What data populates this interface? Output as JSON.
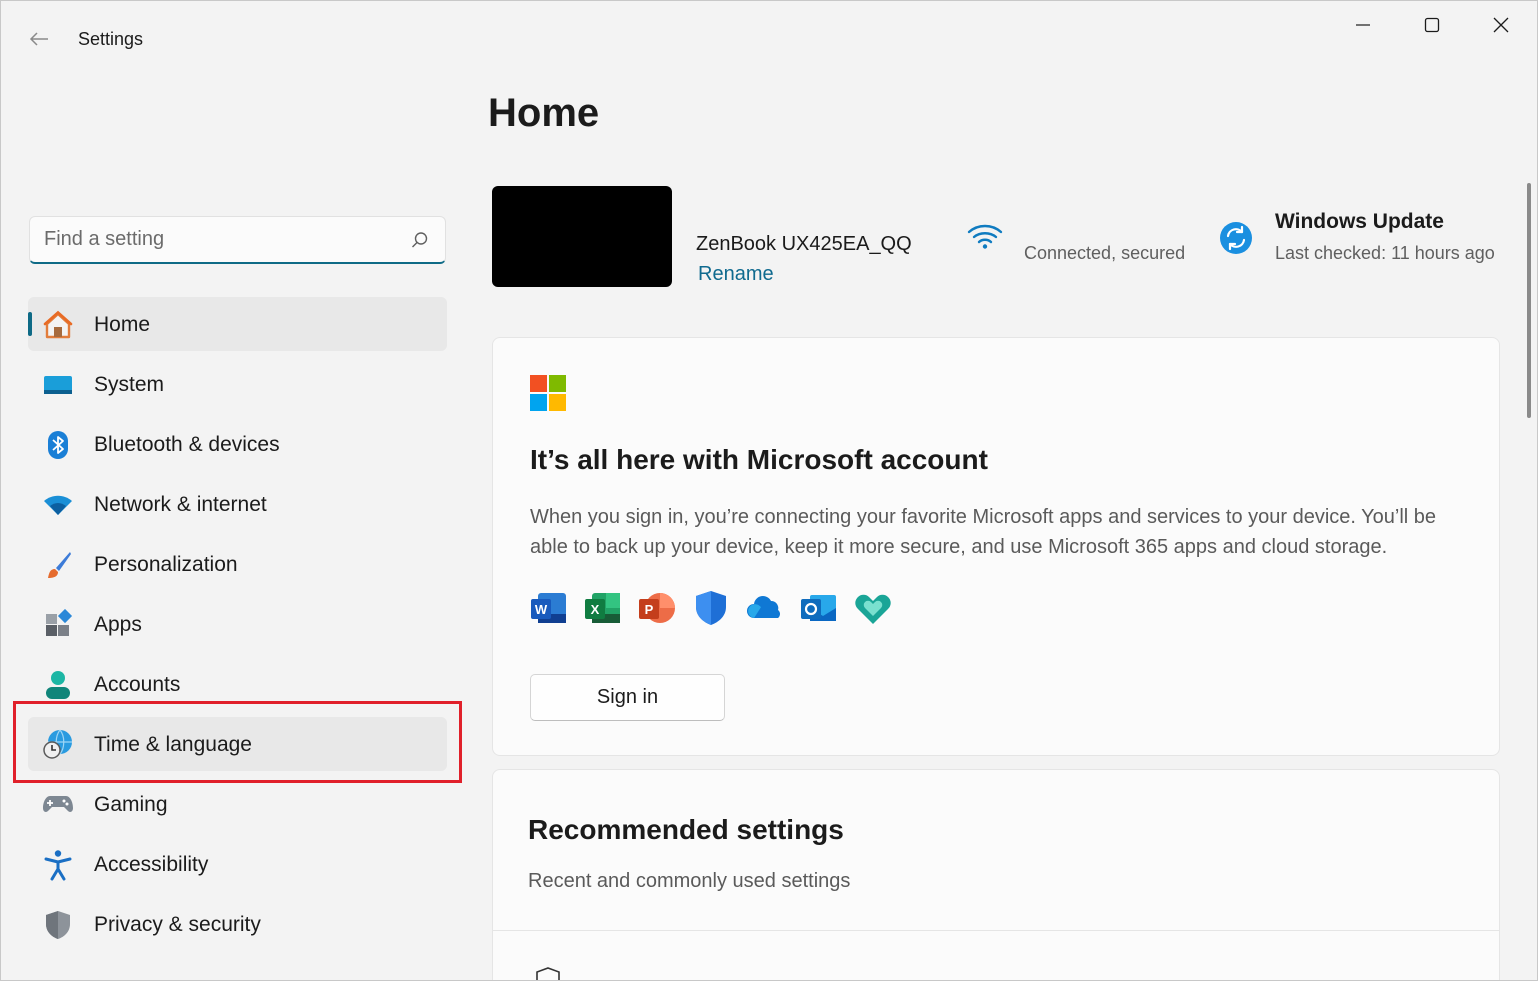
{
  "window": {
    "title": "Settings"
  },
  "sidebar": {
    "search": {
      "placeholder": "Find a setting"
    },
    "items": [
      {
        "label": "Home",
        "icon": "home-icon",
        "active": true
      },
      {
        "label": "System",
        "icon": "system-icon"
      },
      {
        "label": "Bluetooth & devices",
        "icon": "bluetooth-icon"
      },
      {
        "label": "Network & internet",
        "icon": "network-icon"
      },
      {
        "label": "Personalization",
        "icon": "brush-icon"
      },
      {
        "label": "Apps",
        "icon": "apps-icon"
      },
      {
        "label": "Accounts",
        "icon": "accounts-icon"
      },
      {
        "label": "Time & language",
        "icon": "globe-clock-icon",
        "highlighted": true
      },
      {
        "label": "Gaming",
        "icon": "gamepad-icon"
      },
      {
        "label": "Accessibility",
        "icon": "accessibility-icon"
      },
      {
        "label": "Privacy & security",
        "icon": "shield-icon"
      }
    ]
  },
  "main": {
    "title": "Home",
    "device": {
      "name": "ZenBook UX425EA_QQ",
      "rename_label": "Rename"
    },
    "network": {
      "status": "Connected, secured"
    },
    "update": {
      "title": "Windows Update",
      "subtitle": "Last checked: 11 hours ago"
    },
    "ms_account_card": {
      "heading": "It’s all here with Microsoft account",
      "description": "When you sign in, you’re connecting your favorite Microsoft apps and services to your device. You’ll be able to back up your device, keep it more secure, and use Microsoft 365 apps and cloud storage.",
      "apps": [
        "word-icon",
        "excel-icon",
        "powerpoint-icon",
        "defender-icon",
        "onedrive-icon",
        "outlook-icon",
        "family-safety-icon"
      ],
      "signin_label": "Sign in"
    },
    "recommended": {
      "heading": "Recommended settings",
      "subtitle": "Recent and commonly used settings"
    }
  },
  "colors": {
    "accent": "#0e6a86",
    "link": "#0f6a8f",
    "highlight_box": "#e0202a"
  }
}
